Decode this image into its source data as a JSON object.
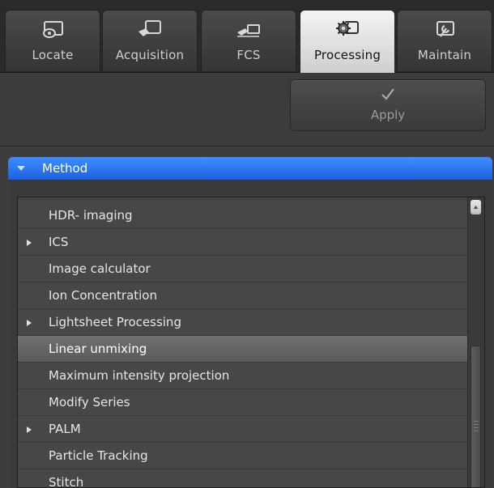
{
  "tabs": [
    {
      "label": "Locate",
      "icon": "locate-icon",
      "active": false
    },
    {
      "label": "Acquisition",
      "icon": "acquisition-icon",
      "active": false
    },
    {
      "label": "FCS",
      "icon": "fcs-icon",
      "active": false
    },
    {
      "label": "Processing",
      "icon": "processing-gear-icon",
      "active": true
    },
    {
      "label": "Maintain",
      "icon": "maintain-wrench-icon",
      "active": false
    }
  ],
  "toolbar": {
    "apply_label": "Apply",
    "apply_icon": "checkmark-icon"
  },
  "method_section": {
    "title": "Method",
    "expanded": true,
    "accent_color": "#2a75f0"
  },
  "method_list": {
    "items": [
      {
        "label": "HDR- imaging",
        "expandable": false,
        "selected": false
      },
      {
        "label": "ICS",
        "expandable": true,
        "selected": false
      },
      {
        "label": "Image calculator",
        "expandable": false,
        "selected": false
      },
      {
        "label": "Ion Concentration",
        "expandable": false,
        "selected": false
      },
      {
        "label": "Lightsheet Processing",
        "expandable": true,
        "selected": false
      },
      {
        "label": "Linear unmixing",
        "expandable": false,
        "selected": true
      },
      {
        "label": "Maximum intensity projection",
        "expandable": false,
        "selected": false
      },
      {
        "label": "Modify Series",
        "expandable": false,
        "selected": false
      },
      {
        "label": "PALM",
        "expandable": true,
        "selected": false
      },
      {
        "label": "Particle Tracking",
        "expandable": false,
        "selected": false
      },
      {
        "label": "Stitch",
        "expandable": false,
        "selected": false
      }
    ]
  }
}
